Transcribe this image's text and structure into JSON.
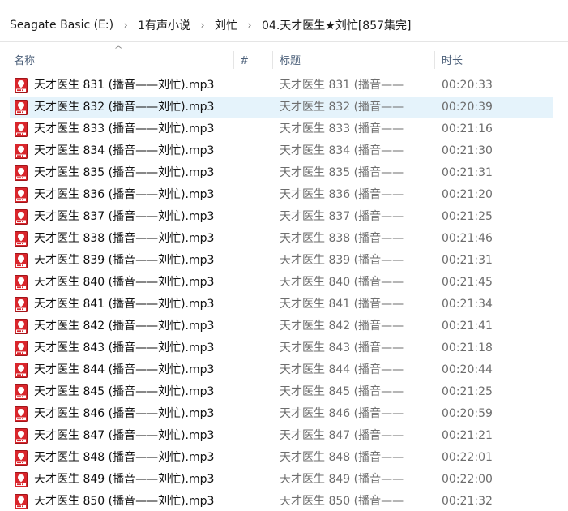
{
  "breadcrumb": {
    "items": [
      "Seagate Basic (E:)",
      "1有声小说",
      "刘忙",
      "04.天才医生★刘忙[857集完]"
    ],
    "separator": "›"
  },
  "columns": {
    "name": "名称",
    "number": "#",
    "title": "标题",
    "duration": "时长"
  },
  "icons": {
    "file": "mp3-file-icon",
    "sort": "sort-ascending-icon"
  },
  "colors": {
    "selected_row": "#e5f3fb",
    "header_text": "#4c607a",
    "icon_red": "#d9262c"
  },
  "files": [
    {
      "name": "天才医生 831 (播音——刘忙).mp3",
      "title": "天才医生 831 (播音——",
      "duration": "00:20:33"
    },
    {
      "name": "天才医生 832 (播音——刘忙).mp3",
      "title": "天才医生 832 (播音——",
      "duration": "00:20:39",
      "selected": true
    },
    {
      "name": "天才医生 833 (播音——刘忙).mp3",
      "title": "天才医生 833 (播音——",
      "duration": "00:21:16"
    },
    {
      "name": "天才医生 834 (播音——刘忙).mp3",
      "title": "天才医生 834 (播音——",
      "duration": "00:21:30"
    },
    {
      "name": "天才医生 835 (播音——刘忙).mp3",
      "title": "天才医生 835 (播音——",
      "duration": "00:21:31"
    },
    {
      "name": "天才医生 836 (播音——刘忙).mp3",
      "title": "天才医生 836 (播音——",
      "duration": "00:21:20"
    },
    {
      "name": "天才医生 837 (播音——刘忙).mp3",
      "title": "天才医生 837 (播音——",
      "duration": "00:21:25"
    },
    {
      "name": "天才医生 838 (播音——刘忙).mp3",
      "title": "天才医生 838 (播音——",
      "duration": "00:21:46"
    },
    {
      "name": "天才医生 839 (播音——刘忙).mp3",
      "title": "天才医生 839 (播音——",
      "duration": "00:21:31"
    },
    {
      "name": "天才医生 840 (播音——刘忙).mp3",
      "title": "天才医生 840 (播音——",
      "duration": "00:21:45"
    },
    {
      "name": "天才医生 841 (播音——刘忙).mp3",
      "title": "天才医生 841 (播音——",
      "duration": "00:21:34"
    },
    {
      "name": "天才医生 842 (播音——刘忙).mp3",
      "title": "天才医生 842 (播音——",
      "duration": "00:21:41"
    },
    {
      "name": "天才医生 843 (播音——刘忙).mp3",
      "title": "天才医生 843 (播音——",
      "duration": "00:21:18"
    },
    {
      "name": "天才医生 844 (播音——刘忙).mp3",
      "title": "天才医生 844 (播音——",
      "duration": "00:20:44"
    },
    {
      "name": "天才医生 845 (播音——刘忙).mp3",
      "title": "天才医生 845 (播音——",
      "duration": "00:21:25"
    },
    {
      "name": "天才医生 846 (播音——刘忙).mp3",
      "title": "天才医生 846 (播音——",
      "duration": "00:20:59"
    },
    {
      "name": "天才医生 847 (播音——刘忙).mp3",
      "title": "天才医生 847 (播音——",
      "duration": "00:21:21"
    },
    {
      "name": "天才医生 848 (播音——刘忙).mp3",
      "title": "天才医生 848 (播音——",
      "duration": "00:22:01"
    },
    {
      "name": "天才医生 849 (播音——刘忙).mp3",
      "title": "天才医生 849 (播音——",
      "duration": "00:22:00"
    },
    {
      "name": "天才医生 850 (播音——刘忙).mp3",
      "title": "天才医生 850 (播音——",
      "duration": "00:21:32"
    }
  ]
}
